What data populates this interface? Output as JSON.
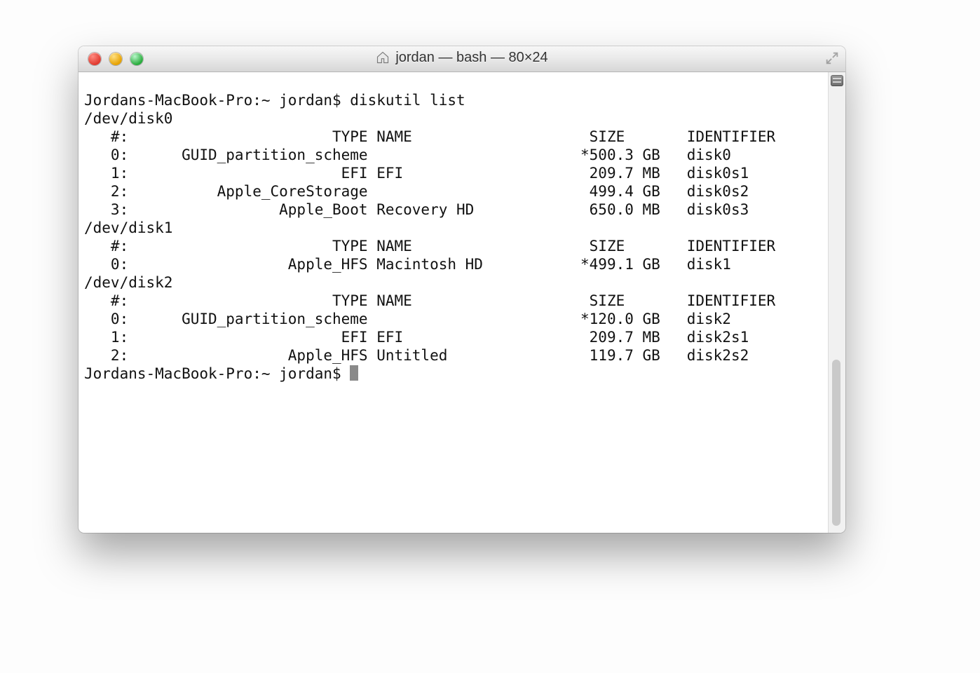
{
  "window": {
    "title": "jordan — bash — 80×24"
  },
  "prompt": {
    "line1": "Jordans-MacBook-Pro:~ jordan$ diskutil list",
    "line2": "Jordans-MacBook-Pro:~ jordan$ "
  },
  "disks": [
    {
      "device": "/dev/disk0",
      "header": "   #:                       TYPE NAME                    SIZE       IDENTIFIER",
      "rows": [
        "   0:      GUID_partition_scheme                        *500.3 GB   disk0",
        "   1:                        EFI EFI                     209.7 MB   disk0s1",
        "   2:          Apple_CoreStorage                         499.4 GB   disk0s2",
        "   3:                 Apple_Boot Recovery HD             650.0 MB   disk0s3"
      ]
    },
    {
      "device": "/dev/disk1",
      "header": "   #:                       TYPE NAME                    SIZE       IDENTIFIER",
      "rows": [
        "   0:                  Apple_HFS Macintosh HD           *499.1 GB   disk1"
      ]
    },
    {
      "device": "/dev/disk2",
      "header": "   #:                       TYPE NAME                    SIZE       IDENTIFIER",
      "rows": [
        "   0:      GUID_partition_scheme                        *120.0 GB   disk2",
        "   1:                        EFI EFI                     209.7 MB   disk2s1",
        "   2:                  Apple_HFS Untitled                119.7 GB   disk2s2"
      ]
    }
  ]
}
